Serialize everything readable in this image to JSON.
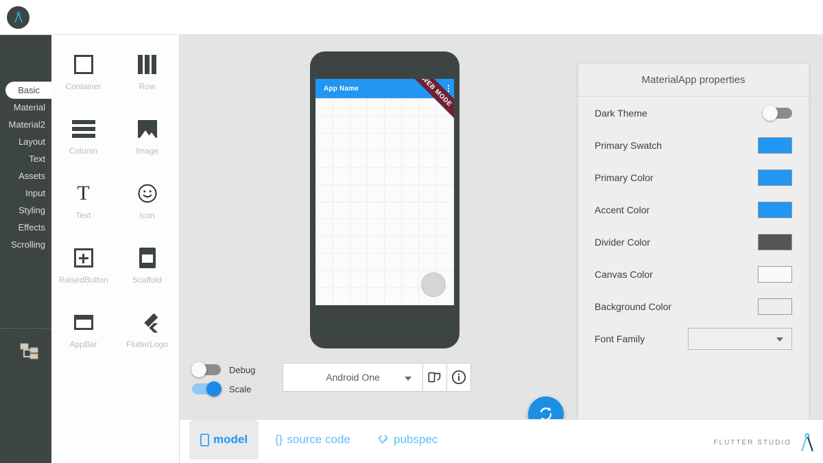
{
  "app": {
    "logo_icon": "compass-divider-icon",
    "brand_name": "FLUTTER STUDIO"
  },
  "sidebar": {
    "categories": [
      {
        "label": "Basic",
        "selected": true
      },
      {
        "label": "Material",
        "selected": false
      },
      {
        "label": "Material2",
        "selected": false
      },
      {
        "label": "Layout",
        "selected": false
      },
      {
        "label": "Text",
        "selected": false
      },
      {
        "label": "Assets",
        "selected": false
      },
      {
        "label": "Input",
        "selected": false
      },
      {
        "label": "Styling",
        "selected": false
      },
      {
        "label": "Effects",
        "selected": false
      },
      {
        "label": "Scrolling",
        "selected": false
      }
    ],
    "tree_icon": "widget-tree-icon"
  },
  "palette": {
    "items": [
      {
        "label": "Container",
        "icon": "square-outline-icon"
      },
      {
        "label": "Row",
        "icon": "columns-bars-icon"
      },
      {
        "label": "Column",
        "icon": "stacked-bars-icon"
      },
      {
        "label": "Image",
        "icon": "image-icon"
      },
      {
        "label": "Text",
        "icon": "text-t-icon"
      },
      {
        "label": "Icon",
        "icon": "smiley-face-icon"
      },
      {
        "label": "RaisedButton",
        "icon": "plus-square-icon"
      },
      {
        "label": "Scaffold",
        "icon": "scaffold-icon"
      },
      {
        "label": "AppBar",
        "icon": "appbar-icon"
      },
      {
        "label": "FlutterLogo",
        "icon": "flutter-logo-icon"
      }
    ]
  },
  "preview": {
    "app_bar_title": "App Name",
    "ribbon_text": "WEB MODE",
    "menu_icon": "overflow-menu-icon",
    "fab_icon": "fab-placeholder"
  },
  "controls": {
    "toggles": [
      {
        "label": "Debug",
        "on": false
      },
      {
        "label": "Scale",
        "on": true
      }
    ],
    "device": {
      "value": "Android One",
      "caret_icon": "chevron-down-icon"
    },
    "rotate_button_icon": "screen-rotation-icon",
    "info_button_icon": "info-circle-icon",
    "refresh_button_icon": "refresh-sync-icon"
  },
  "properties": {
    "title": "MaterialApp properties",
    "rows": [
      {
        "label": "Dark Theme",
        "type": "toggle",
        "on": false
      },
      {
        "label": "Primary Swatch",
        "type": "color",
        "color": "#2196f3"
      },
      {
        "label": "Primary Color",
        "type": "color",
        "color": "#2196f3"
      },
      {
        "label": "Accent Color",
        "type": "color",
        "color": "#2196f3"
      },
      {
        "label": "Divider Color",
        "type": "color",
        "color": "#555555"
      },
      {
        "label": "Canvas Color",
        "type": "color",
        "color": "#fafafa"
      },
      {
        "label": "Background Color",
        "type": "color",
        "color": "#eeeeee"
      },
      {
        "label": "Font Family",
        "type": "select",
        "value": ""
      }
    ]
  },
  "tabs": [
    {
      "label": "model",
      "icon": "phone-outline-icon",
      "active": true
    },
    {
      "label": "source code",
      "icon": "curly-braces-icon",
      "active": false
    },
    {
      "label": "pubspec",
      "icon": "code-check-icon",
      "active": false
    }
  ]
}
